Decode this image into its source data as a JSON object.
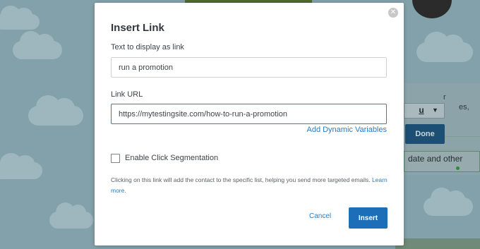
{
  "modal": {
    "title": "Insert Link",
    "close_icon": "close-icon",
    "close_glyph": "✕",
    "display_text": {
      "label": "Text to display as link",
      "value": "run a promotion"
    },
    "link_url": {
      "label": "Link URL",
      "value": "https://mytestingsite.com/how-to-run-a-promotion"
    },
    "dynamic_variables_label": "Add Dynamic Variables",
    "click_segmentation": {
      "label": "Enable Click Segmentation",
      "checked": false
    },
    "help_text": "Clicking on this link will add the contact to the specific list, helping you send more targeted emails.",
    "learn_more_label": "Learn more.",
    "cancel_label": "Cancel",
    "insert_label": "Insert"
  },
  "background": {
    "editor_text_line1": "r",
    "editor_text_line2": "es,",
    "underline_button_label": "u",
    "chevron_icon": "chevron-down-icon",
    "done_label": "Done",
    "field_text": "date and other"
  },
  "colors": {
    "primary": "#1c6eb8",
    "link": "#2a7bc0",
    "focus_border": "#2f7fc4",
    "overlay": "#83a1aa"
  }
}
